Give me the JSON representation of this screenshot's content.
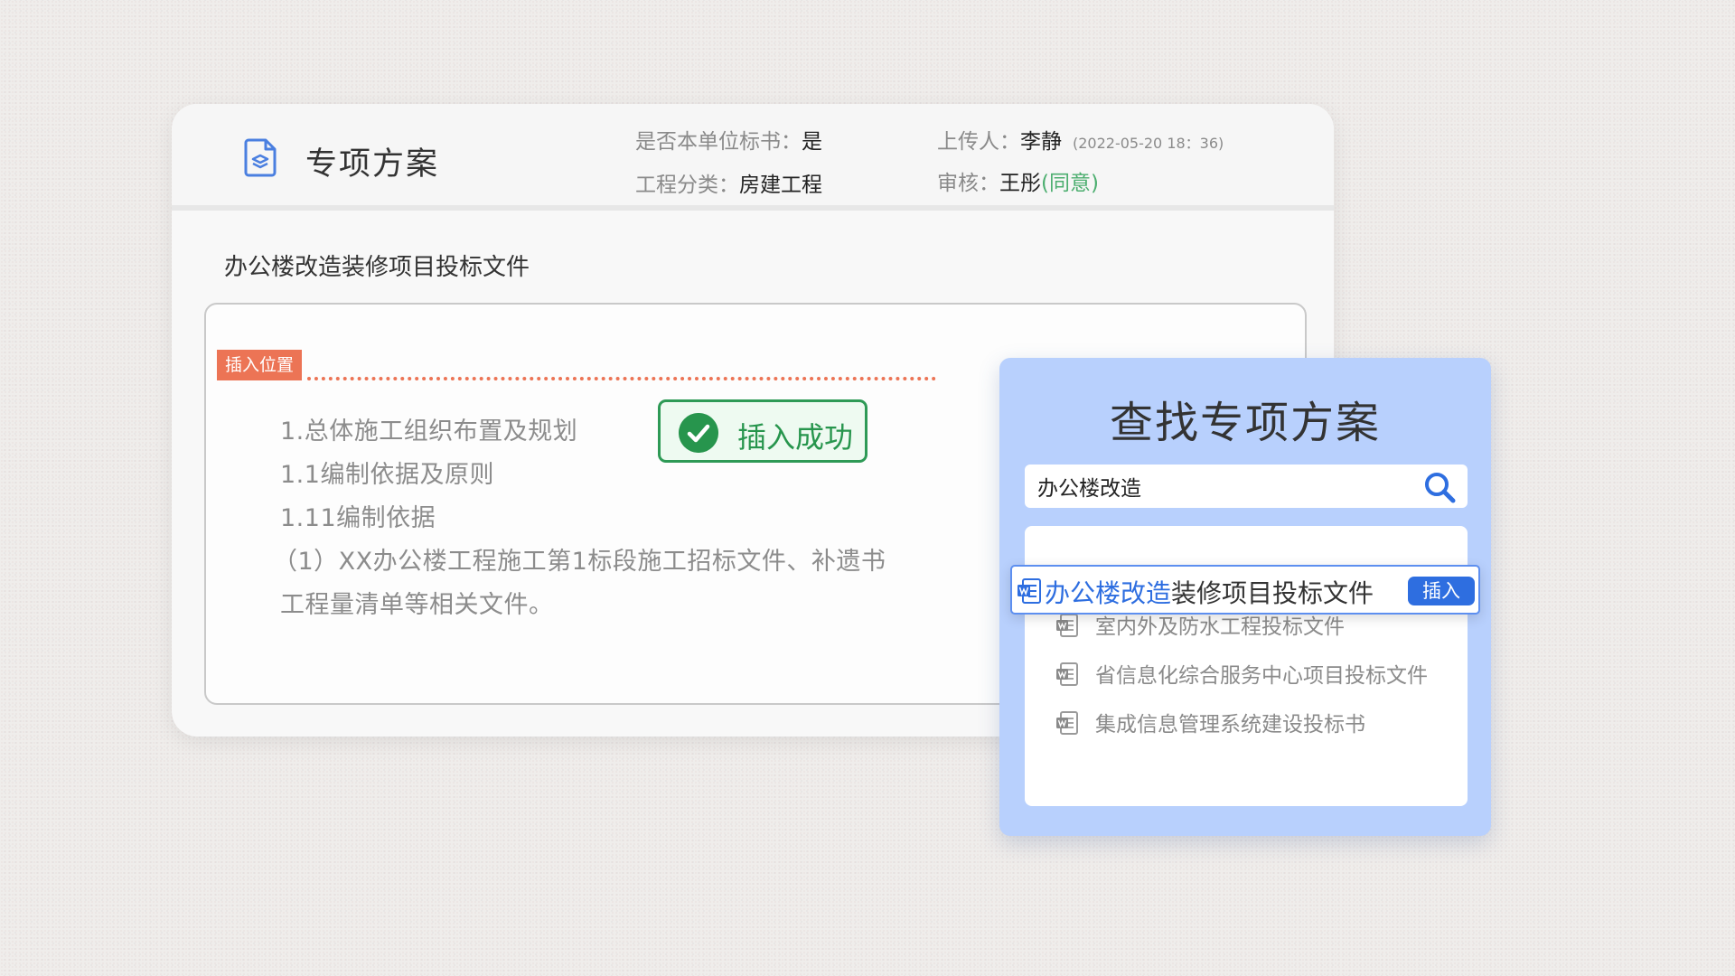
{
  "header": {
    "title": "专项方案",
    "own_label": "是否本单位标书：",
    "own_value": "是",
    "category_label": "工程分类：",
    "category_value": "房建工程",
    "uploader_label": "上传人：",
    "uploader_value": "李静",
    "upload_time": "(2022-05-20 18：36)",
    "review_label": "审核：",
    "review_value": "王彤",
    "review_status": "(同意)"
  },
  "document": {
    "name": "办公楼改造装修项目投标文件",
    "insert_tag": "插入位置",
    "outline": [
      "1.总体施工组织布置及规划",
      "1.1编制依据及原则",
      "1.11编制依据",
      "（1）XX办公楼工程施工第1标段施工招标文件、补遗书",
      "工程量清单等相关文件。"
    ],
    "success_message": "插入成功"
  },
  "search_panel": {
    "title": "查找专项方案",
    "query": "办公楼改造",
    "active_result": {
      "highlight": "办公楼改造",
      "rest": "装修项目投标文件",
      "button": "插入"
    },
    "results": [
      "室内外及防水工程投标文件",
      "省信息化综合服务中心项目投标文件",
      "集成信息管理系统建设投标书"
    ]
  },
  "colors": {
    "accent_blue": "#2e6ee0",
    "insert_orange": "#ec7455",
    "success_green": "#27954d",
    "panel_bg": "#b8d0fd"
  },
  "icons": {
    "header": "document-layers-icon",
    "search": "search-icon",
    "result": "word-doc-icon",
    "success": "check-circle-icon"
  }
}
